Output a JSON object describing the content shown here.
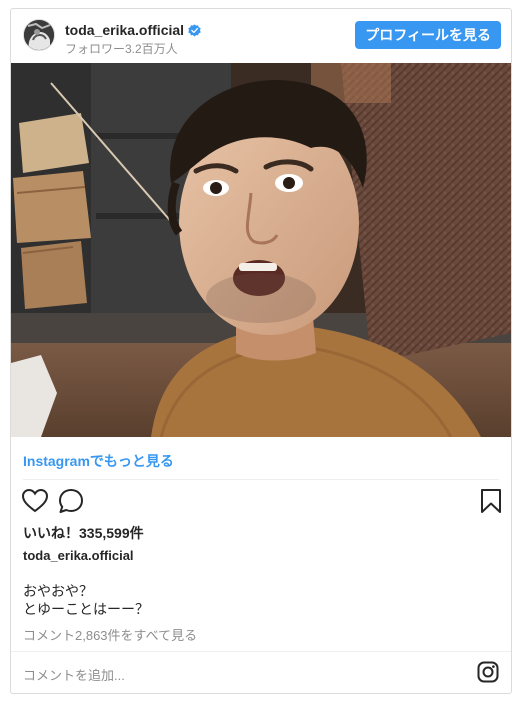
{
  "header": {
    "username": "toda_erika.official",
    "followers": "フォロワー3.2百万人",
    "profile_button": "プロフィールを見る"
  },
  "media": {
    "more_on_instagram": "Instagramでもっと見る"
  },
  "engagement": {
    "likes": "いいね！335,599件"
  },
  "post": {
    "author": "toda_erika.official",
    "caption_lines": [
      "おやおや？",
      "とゆーことはーー？"
    ],
    "view_comments": "コメント2,863件をすべて見る"
  },
  "comment": {
    "placeholder": "コメントを追加..."
  },
  "colors": {
    "accent": "#3897f0",
    "muted_text": "#8e8e8e",
    "border": "#dbdbdb"
  },
  "icons": [
    "verified-badge-icon",
    "heart-icon",
    "comment-icon",
    "bookmark-icon",
    "instagram-logo-icon"
  ]
}
